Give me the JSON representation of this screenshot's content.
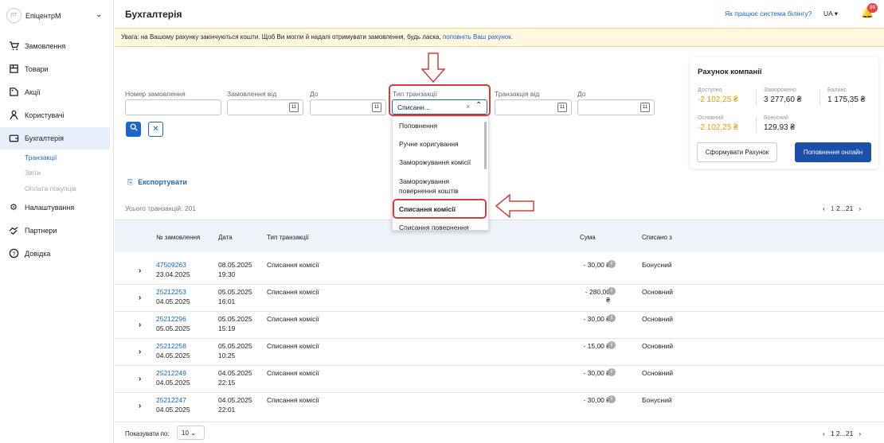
{
  "brand": {
    "avatar": "ЛТ",
    "name": "ЕпіцентрМ"
  },
  "sidebar": {
    "items": [
      {
        "label": "Замовлення",
        "icon": "cart-icon"
      },
      {
        "label": "Товари",
        "icon": "box-icon"
      },
      {
        "label": "Акції",
        "icon": "tag-icon"
      },
      {
        "label": "Користувачі",
        "icon": "users-icon"
      },
      {
        "label": "Бухгалтерія",
        "icon": "wallet-icon"
      },
      {
        "label": "Налаштування",
        "icon": "gear-icon"
      },
      {
        "label": "Партнери",
        "icon": "handshake-icon"
      },
      {
        "label": "Довідка",
        "icon": "help-icon"
      }
    ],
    "subitems": [
      "Транзакції",
      "Звіти",
      "Оплата покупців"
    ]
  },
  "header": {
    "title": "Бухгалтерія",
    "billing_link": "Як працює система білінгу?",
    "lang": "UA",
    "notif_count": "99"
  },
  "warning": {
    "text": "Увага: на Вашому рахунку закінчуються кошти. Щоб Ви могли й надалі отримувати замовлення, будь ласка, ",
    "link": "поповніть Ваш рахунок."
  },
  "filters": {
    "order_number": "Номер замовлення",
    "order_from": "Замовлення від",
    "to": "До",
    "tx_type": "Тип транзакції",
    "tx_type_value": "Списанн...",
    "tx_from": "Транзакція від",
    "to2": "До"
  },
  "dropdown": {
    "options": [
      "Поповнення",
      "Ручне коригування",
      "Заморожування комісії",
      "Заморожування повернення коштів",
      "Списання комісії",
      "Списання повернення"
    ],
    "selected_index": 4
  },
  "export_label": "Експортувати",
  "account": {
    "title": "Рахунок компанії",
    "available_label": "Доступно",
    "available": "-2 102,25 ₴",
    "frozen_label": "Заморожено",
    "frozen": "3 277,60 ₴",
    "balance_label": "Баланс",
    "balance": "1 175,35 ₴",
    "main_label": "Основний",
    "main": "-2 102,25 ₴",
    "bonus_label": "Бонусний",
    "bonus": "129,93 ₴",
    "invoice_btn": "Сформувати Рахунок",
    "topup_btn": "Поповнення онлайн"
  },
  "table": {
    "total": "Усього транзакцій: 201",
    "pager": {
      "current": "1",
      "rest": "2...21"
    },
    "headers": {
      "order": "№ замовлення",
      "date": "Дата",
      "type": "Тип транзакції",
      "amount": "Сума",
      "source": "Списано з"
    },
    "rows": [
      {
        "order": "47509263",
        "order_date": "23.04.2025",
        "date": "08.05.2025",
        "time": "19:30",
        "type": "Списання комісії",
        "amount": "- 30,00 ₴",
        "source": "Бонусний"
      },
      {
        "order": "25212253",
        "order_date": "04.05.2025",
        "date": "05.05.2025",
        "time": "16:01",
        "type": "Списання комісії",
        "amount": "- 280,00 ₴",
        "source": "Основний"
      },
      {
        "order": "25212296",
        "order_date": "05.05.2025",
        "date": "05.05.2025",
        "time": "15:19",
        "type": "Списання комісії",
        "amount": "- 30,00 ₴",
        "source": "Основний"
      },
      {
        "order": "25212258",
        "order_date": "04.05.2025",
        "date": "05.05.2025",
        "time": "10:25",
        "type": "Списання комісії",
        "amount": "- 15,00 ₴",
        "source": "Основний"
      },
      {
        "order": "25212249",
        "order_date": "04.05.2025",
        "date": "04.05.2025",
        "time": "22:15",
        "type": "Списання комісії",
        "amount": "- 30,00 ₴",
        "source": "Основний"
      },
      {
        "order": "25212247",
        "order_date": "04.05.2025",
        "date": "04.05.2025",
        "time": "22:01",
        "type": "Списання комісії",
        "amount": "- 30,00 ₴",
        "source": "Бонусний"
      }
    ]
  },
  "footer": {
    "per_page_label": "Показувати по:",
    "per_page": "10"
  }
}
